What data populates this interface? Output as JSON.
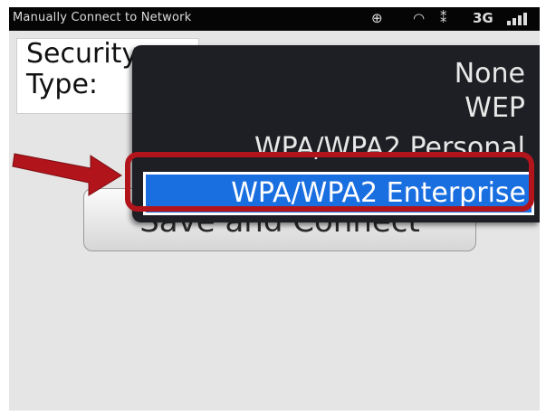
{
  "status_bar": {
    "title": "Manually Connect to Network",
    "network_type": "3G",
    "icons": [
      "gps-icon",
      "wifi-icon",
      "data-icon",
      "signal-bars-icon"
    ]
  },
  "form": {
    "security_label": "Security Type:",
    "save_button_label": "Save and Connect"
  },
  "dropdown": {
    "options": [
      "None",
      "WEP",
      "WPA/WPA2 Personal",
      "WPA/WPA2 Enterprise"
    ],
    "selected": "WPA/WPA2 Enterprise"
  },
  "colors": {
    "highlight_ring": "#b2141b",
    "selection": "#1a6fe0",
    "menu_bg": "#1d1f24"
  }
}
